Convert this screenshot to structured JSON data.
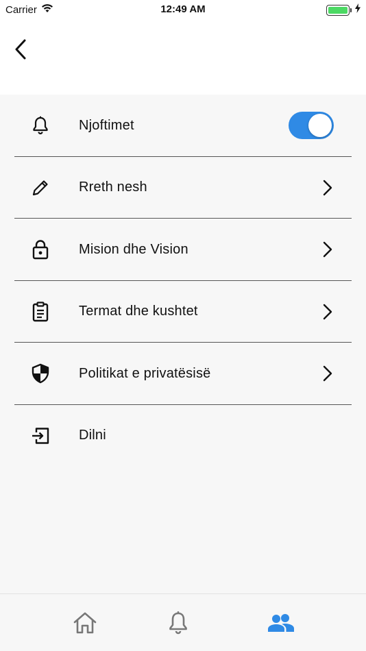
{
  "status_bar": {
    "carrier": "Carrier",
    "time": "12:49 AM"
  },
  "menu": {
    "items": [
      {
        "label": "Njoftimet",
        "icon": "bell-icon",
        "control": "toggle",
        "toggle_on": true
      },
      {
        "label": "Rreth nesh",
        "icon": "pencil-icon",
        "control": "chevron"
      },
      {
        "label": "Mision dhe Vision",
        "icon": "lock-icon",
        "control": "chevron"
      },
      {
        "label": "Termat dhe kushtet",
        "icon": "clipboard-icon",
        "control": "chevron"
      },
      {
        "label": "Politikat e privatësisë",
        "icon": "shield-icon",
        "control": "chevron"
      },
      {
        "label": "Dilni",
        "icon": "logout-icon",
        "control": "none"
      }
    ]
  },
  "tab_bar": {
    "tabs": [
      {
        "name": "home",
        "icon": "home-icon",
        "active": false
      },
      {
        "name": "notifications",
        "icon": "bell-icon",
        "active": false
      },
      {
        "name": "people",
        "icon": "people-icon",
        "active": true
      }
    ]
  },
  "colors": {
    "accent": "#2f8ae5",
    "background": "#f7f7f7",
    "inactive_icon": "#777777",
    "battery": "#4cd964"
  }
}
